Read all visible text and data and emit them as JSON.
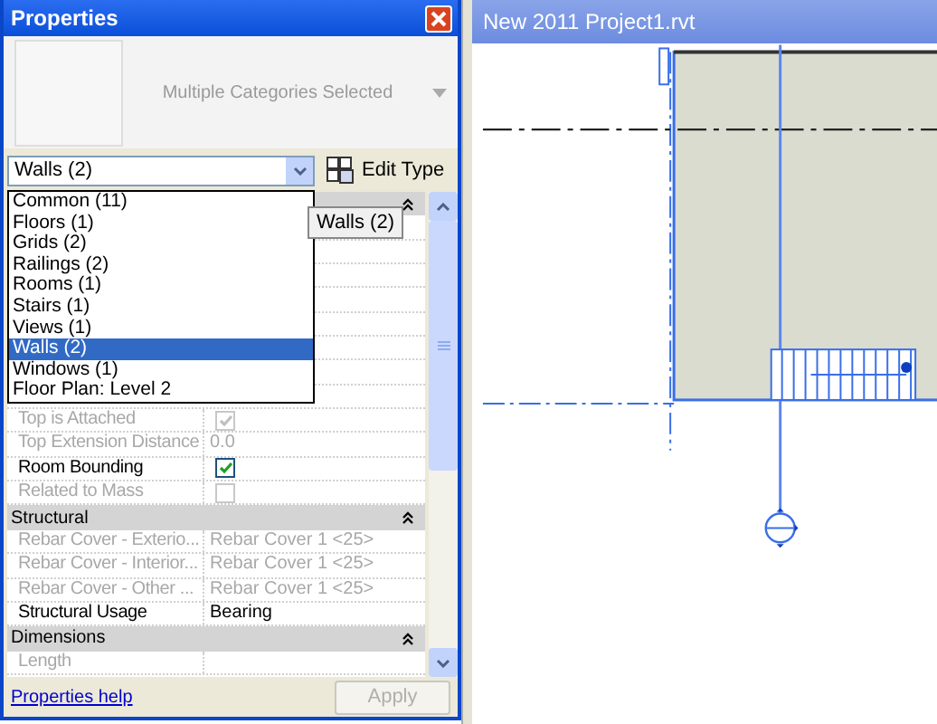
{
  "panel": {
    "title": "Properties"
  },
  "type_selector": {
    "label": "Multiple Categories Selected"
  },
  "filter": {
    "value": "Walls (2)",
    "options": [
      {
        "label": "Common (11)",
        "selected": false
      },
      {
        "label": "Floors (1)",
        "selected": false
      },
      {
        "label": "Grids (2)",
        "selected": false
      },
      {
        "label": "Railings (2)",
        "selected": false
      },
      {
        "label": "Rooms (1)",
        "selected": false
      },
      {
        "label": "Stairs (1)",
        "selected": false
      },
      {
        "label": "Views (1)",
        "selected": false
      },
      {
        "label": "Walls (2)",
        "selected": true
      },
      {
        "label": "Windows (1)",
        "selected": false
      },
      {
        "label": "Floor Plan: Level 2",
        "selected": false
      }
    ]
  },
  "tooltip": "Walls (2)",
  "edit_type": "Edit Type",
  "properties": [
    {
      "kind": "check",
      "label": "Top is Attached",
      "checked": true,
      "disabled": true
    },
    {
      "kind": "text",
      "label": "Top Extension Distance",
      "value": "0.0",
      "disabled": true
    },
    {
      "kind": "check",
      "label": "Room Bounding",
      "checked": true,
      "disabled": false
    },
    {
      "kind": "check",
      "label": "Related to Mass",
      "checked": false,
      "disabled": true
    },
    {
      "kind": "group",
      "label": "Structural",
      "expanded": true
    },
    {
      "kind": "text",
      "label": "Rebar Cover - Exterio...",
      "value": "Rebar Cover 1 <25>",
      "disabled": true
    },
    {
      "kind": "text",
      "label": "Rebar Cover - Interior...",
      "value": "Rebar Cover 1 <25>",
      "disabled": true
    },
    {
      "kind": "text",
      "label": "Rebar Cover - Other ...",
      "value": "Rebar Cover 1 <25>",
      "disabled": true
    },
    {
      "kind": "text",
      "label": "Structural Usage",
      "value": "Bearing",
      "disabled": false
    },
    {
      "kind": "group",
      "label": "Dimensions",
      "expanded": true
    },
    {
      "kind": "text",
      "label": "Length",
      "disabled": true
    }
  ],
  "help_link": "Properties help",
  "apply": {
    "label": "Apply",
    "disabled": true
  },
  "view": {
    "title": "New 2011 Project1.rvt"
  }
}
